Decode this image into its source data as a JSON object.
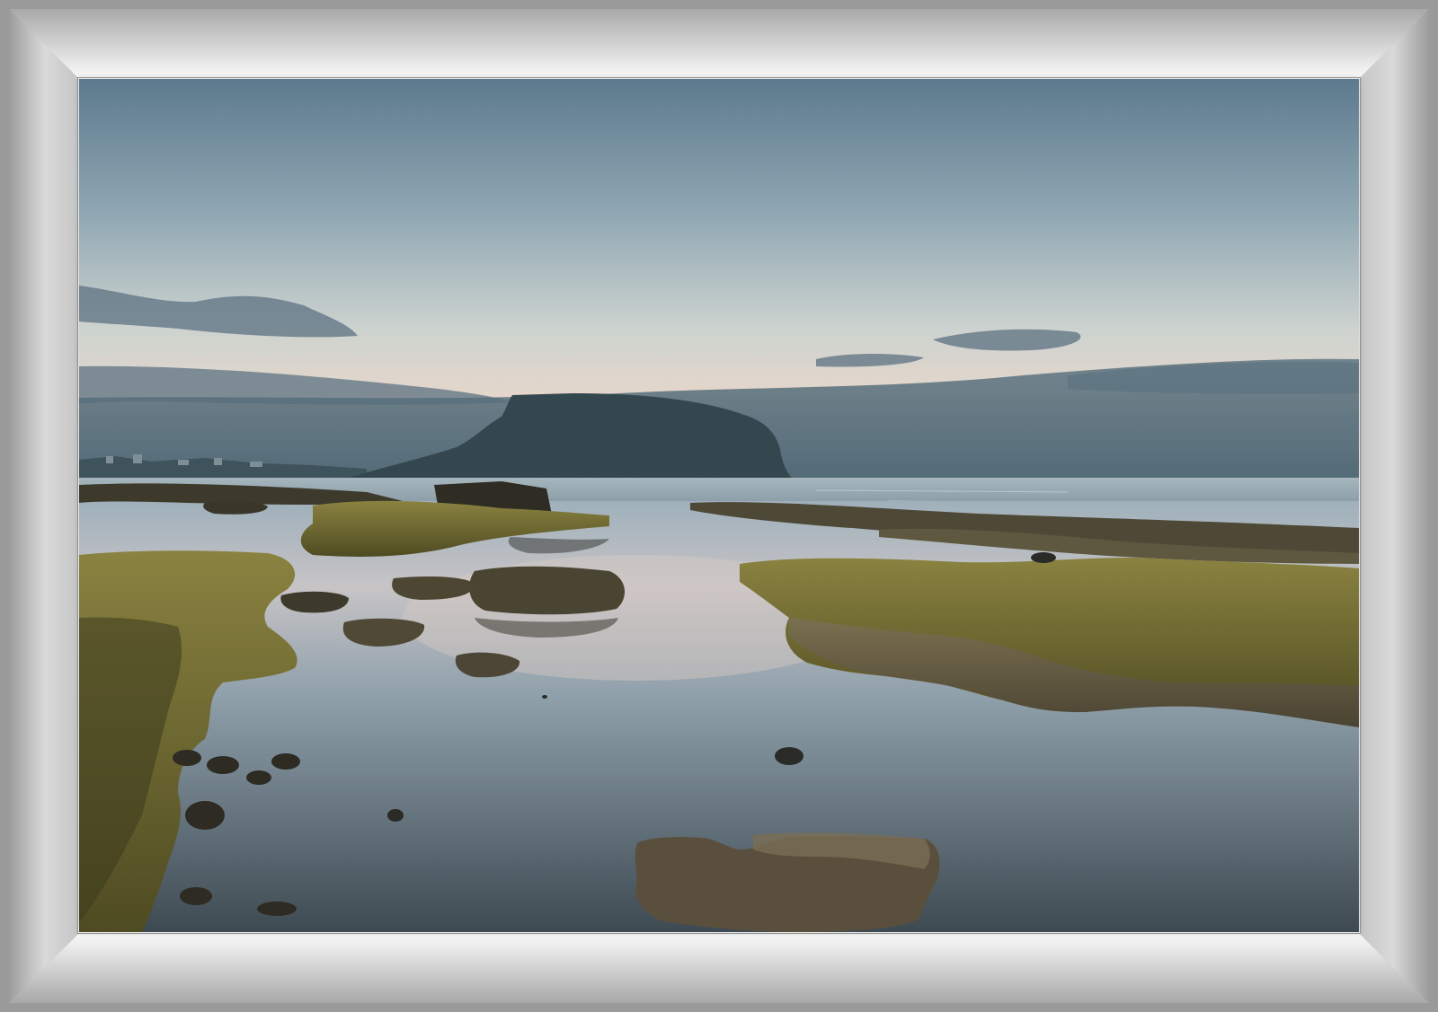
{
  "image": {
    "colors": {
      "frame_outer": "#9a9a9a",
      "mat": "#c2c2c2",
      "sky_top": "#5f7c90",
      "sky_mid": "#aebfc4",
      "sky_glow": "#e4d6cb",
      "sea": "#7f95a2",
      "mountain": "#34474f",
      "moss": "#6d6a2e",
      "rock": "#4f4a35",
      "tide_pool": "#8a9aa5"
    }
  }
}
